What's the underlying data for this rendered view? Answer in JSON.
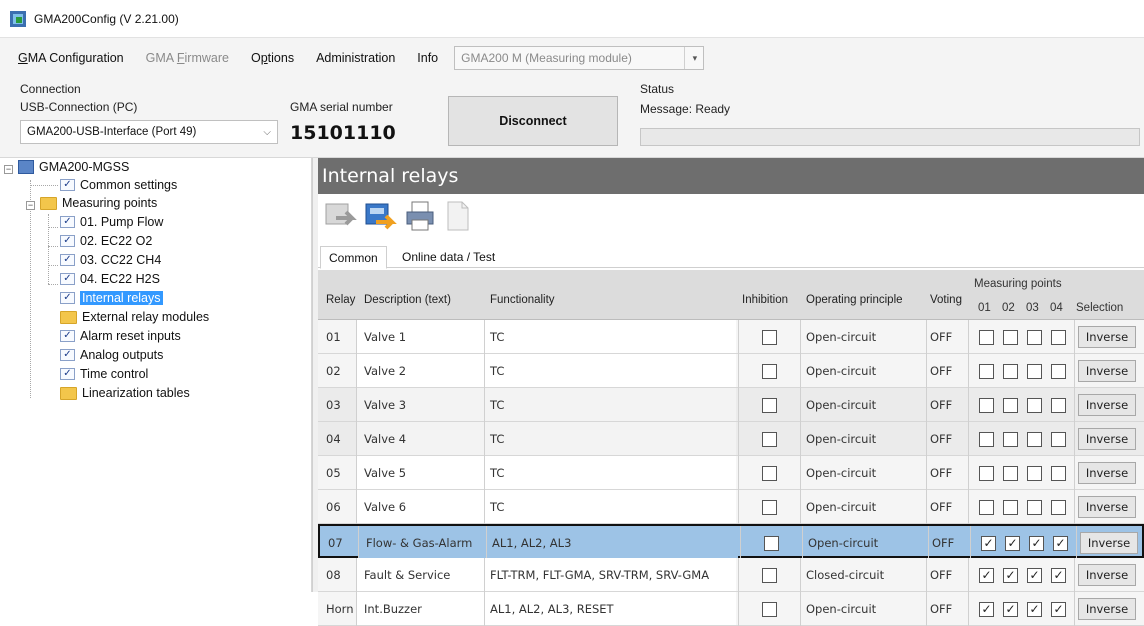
{
  "window": {
    "title": "GMA200Config (V 2.21.00)"
  },
  "menu": {
    "items": [
      {
        "label": "GMA Configuration",
        "mnemonic": "G",
        "disabled": false
      },
      {
        "label": "GMA Firmware",
        "mnemonic": "F",
        "disabled": true
      },
      {
        "label": "Options",
        "mnemonic": "p",
        "disabled": false
      },
      {
        "label": "Administration",
        "mnemonic": "",
        "disabled": false
      },
      {
        "label": "Info",
        "mnemonic": "",
        "disabled": false
      }
    ],
    "module_select": "GMA200 M (Measuring module)"
  },
  "connection": {
    "group_label": "Connection",
    "usb_label": "USB-Connection (PC)",
    "usb_value": "GMA200-USB-Interface (Port 49)",
    "serial_label": "GMA serial number",
    "serial_value": "15101110",
    "disconnect_label": "Disconnect"
  },
  "status": {
    "group_label": "Status",
    "message": "Message: Ready"
  },
  "tree": {
    "root": "GMA200-MGSS",
    "common": "Common settings",
    "measuring": "Measuring points",
    "mp1": "01. Pump  Flow",
    "mp2": "02. EC22  O2",
    "mp3": "03. CC22  CH4",
    "mp4": "04. EC22  H2S",
    "relays": "Internal relays",
    "ext": "External relay modules",
    "alarm": "Alarm reset inputs",
    "analog": "Analog outputs",
    "time": "Time control",
    "lin": "Linearization tables"
  },
  "panel": {
    "title": "Internal relays",
    "tabs": [
      "Common",
      "Online data / Test"
    ]
  },
  "grid": {
    "headers": {
      "relay": "Relay",
      "description": "Description (text)",
      "functionality": "Functionality",
      "inhibition": "Inhibition",
      "operating": "Operating principle",
      "voting": "Voting",
      "measuring_points": "Measuring points",
      "mp_cols": [
        "01",
        "02",
        "03",
        "04"
      ],
      "selection": "Selection"
    },
    "rows": [
      {
        "relay": "01",
        "desc": "Valve 1",
        "func": "TC",
        "op": "Open-circuit",
        "voting": "OFF",
        "mp": [
          false,
          false,
          false,
          false
        ],
        "sel": "Inverse"
      },
      {
        "relay": "02",
        "desc": "Valve 2",
        "func": "TC",
        "op": "Open-circuit",
        "voting": "OFF",
        "mp": [
          false,
          false,
          false,
          false
        ],
        "sel": "Inverse"
      },
      {
        "relay": "03",
        "desc": "Valve 3",
        "func": "TC",
        "op": "Open-circuit",
        "voting": "OFF",
        "mp": [
          false,
          false,
          false,
          false
        ],
        "sel": "Inverse"
      },
      {
        "relay": "04",
        "desc": "Valve 4",
        "func": "TC",
        "op": "Open-circuit",
        "voting": "OFF",
        "mp": [
          false,
          false,
          false,
          false
        ],
        "sel": "Inverse"
      },
      {
        "relay": "05",
        "desc": "Valve 5",
        "func": "TC",
        "op": "Open-circuit",
        "voting": "OFF",
        "mp": [
          false,
          false,
          false,
          false
        ],
        "sel": "Inverse"
      },
      {
        "relay": "06",
        "desc": "Valve 6",
        "func": "TC",
        "op": "Open-circuit",
        "voting": "OFF",
        "mp": [
          false,
          false,
          false,
          false
        ],
        "sel": "Inverse"
      },
      {
        "relay": "07",
        "desc": "Flow- & Gas-Alarm",
        "func": "AL1, AL2, AL3",
        "op": "Open-circuit",
        "voting": "OFF",
        "mp": [
          true,
          true,
          true,
          true
        ],
        "sel": "Inverse",
        "selected": true
      },
      {
        "relay": "08",
        "desc": "Fault & Service",
        "func": "FLT-TRM, FLT-GMA, SRV-TRM, SRV-GMA",
        "op": "Closed-circuit",
        "voting": "OFF",
        "mp": [
          true,
          true,
          true,
          true
        ],
        "sel": "Inverse"
      },
      {
        "relay": "Horn",
        "desc": "Int.Buzzer",
        "func": "AL1, AL2, AL3, RESET",
        "op": "Open-circuit",
        "voting": "OFF",
        "mp": [
          true,
          true,
          true,
          true
        ],
        "sel": "Inverse"
      }
    ]
  },
  "colors": {
    "header_bg": "#6e6e6e",
    "selected_row": "#9dc3e6",
    "tree_selected": "#3399ff"
  }
}
